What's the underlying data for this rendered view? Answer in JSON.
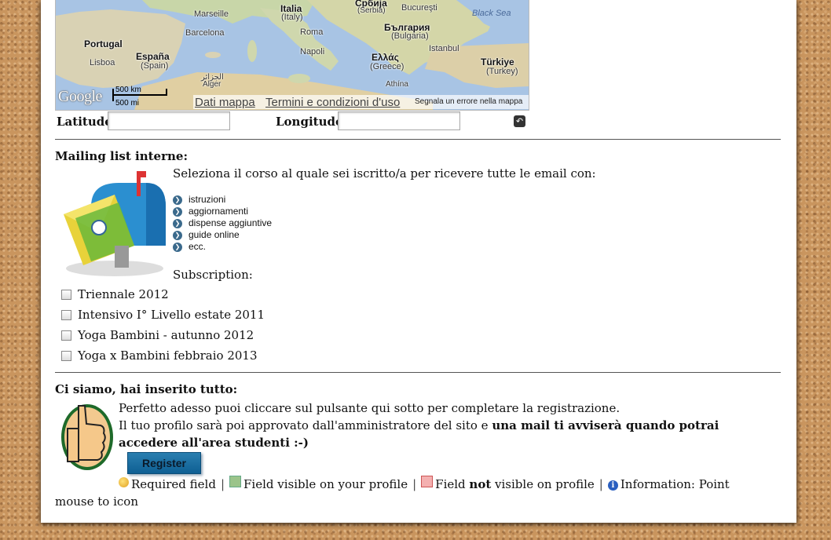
{
  "map": {
    "labels": {
      "portugal": "Portugal",
      "lisboa": "Lisboa",
      "espana": "España",
      "spain": "(Spain)",
      "marseille": "Marseille",
      "barcelona": "Barcelona",
      "italia": "Italia",
      "italy": "(Italy)",
      "roma": "Roma",
      "napoli": "Napoli",
      "srbija": "Србија",
      "serbia": "(Serbia)",
      "bucuresti": "Bucureşti",
      "balgaria": "България",
      "bulgaria": "(Bulgaria)",
      "istanbul": "Istanbul",
      "ellas": "Ελλάς",
      "greece": "(Greece)",
      "athina": "Athína",
      "turkiye": "Türkiye",
      "turkey": "(Turkey)",
      "black_sea": "Black Sea",
      "algeria_ar": "الجزائر",
      "alger": "Alger"
    },
    "google_logo": "Google",
    "scale_km": "500 km",
    "scale_mi": "500 mi",
    "map_data_link": "Dati mappa",
    "terms_link": "Termini e condizioni d'uso",
    "report_error": "Segnala un errore nella mappa"
  },
  "coords": {
    "latitude_label": "Latitude",
    "latitude_value": "",
    "longitude_label": "Longitude",
    "longitude_value": "",
    "reset_icon": "undo-icon"
  },
  "mailing": {
    "heading": "Mailing list interne:",
    "intro": "Seleziona il corso al quale sei iscritto/a per ricevere tutte le email con:",
    "bullets": [
      "istruzioni",
      "aggiornamenti",
      "dispense aggiuntive",
      "guide online",
      "ecc."
    ],
    "subscription_label": "Subscription:",
    "courses": [
      {
        "label": "Triennale 2012",
        "checked": false
      },
      {
        "label": "Intensivo I° Livello estate 2011",
        "checked": false
      },
      {
        "label": "Yoga Bambini - autunno 2012",
        "checked": false
      },
      {
        "label": "Yoga x Bambini febbraio 2013",
        "checked": false
      }
    ]
  },
  "final": {
    "heading": "Ci siamo, hai inserito tutto:",
    "line1": "Perfetto adesso puoi cliccare sul pulsante qui sotto per completare la registrazione.",
    "line2_plain": "Il tuo profilo sarà poi approvato dall'amministratore del sito e ",
    "line2_bold": "una mail ti avviserà quando potrai accedere all'area studenti :-)",
    "register_label": "Register"
  },
  "legend": {
    "required": "Required field",
    "visible": "Field visible on your profile",
    "not_visible_pre": "Field ",
    "not_visible_bold": "not",
    "not_visible_post": " visible on profile",
    "info": "Information: Point mouse to icon",
    "separator": "|"
  }
}
